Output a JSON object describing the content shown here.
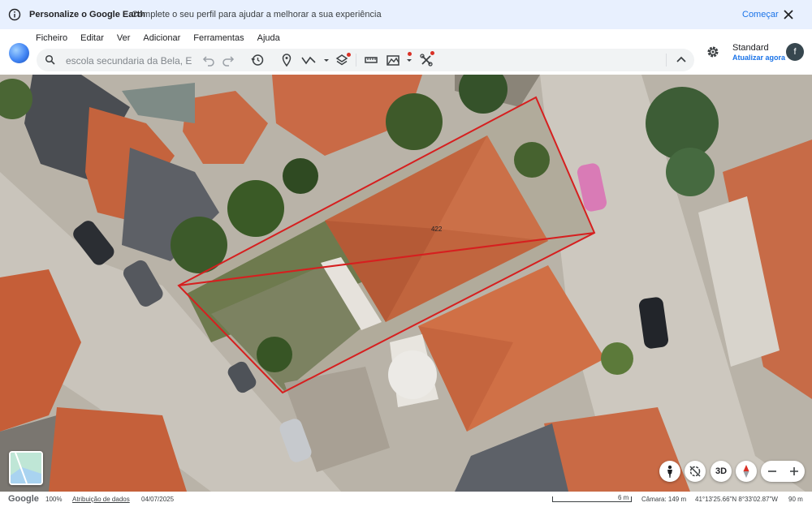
{
  "banner": {
    "title": "Personalize o Google Earth",
    "message": "Complete o seu perfil para ajudar a melhorar a sua experiência",
    "action": "Começar",
    "info_icon": "info-icon",
    "close_icon": "close-icon"
  },
  "menu": {
    "items": [
      "Ficheiro",
      "Editar",
      "Ver",
      "Adicionar",
      "Ferramentas",
      "Ajuda"
    ]
  },
  "search": {
    "value": "",
    "placeholder": "escola secundaria da Bela, Erme"
  },
  "toolbar": {
    "icons": [
      "undo-icon",
      "redo-icon",
      "history-icon",
      "placemark-icon",
      "path-icon",
      "layers-icon",
      "ruler-icon",
      "elevation-icon",
      "tools-icon",
      "chevron-up-icon"
    ]
  },
  "view": {
    "label": "Standard",
    "update_link": "Atualizar agora",
    "avatar_letter": "f"
  },
  "map": {
    "parcel_label": "422",
    "parcel_outline_color": "#d61f1f"
  },
  "map_controls": {
    "threed_label": "3D"
  },
  "status": {
    "brand": "Google",
    "zoom": "100%",
    "attribution": "Atribuição de dados",
    "date": "04/07/2025",
    "scale": "6 m",
    "camera": "Câmara: 149 m",
    "coords": "41°13'25.66\"N 8°33'02.87\"W",
    "altitude": "90 m"
  }
}
